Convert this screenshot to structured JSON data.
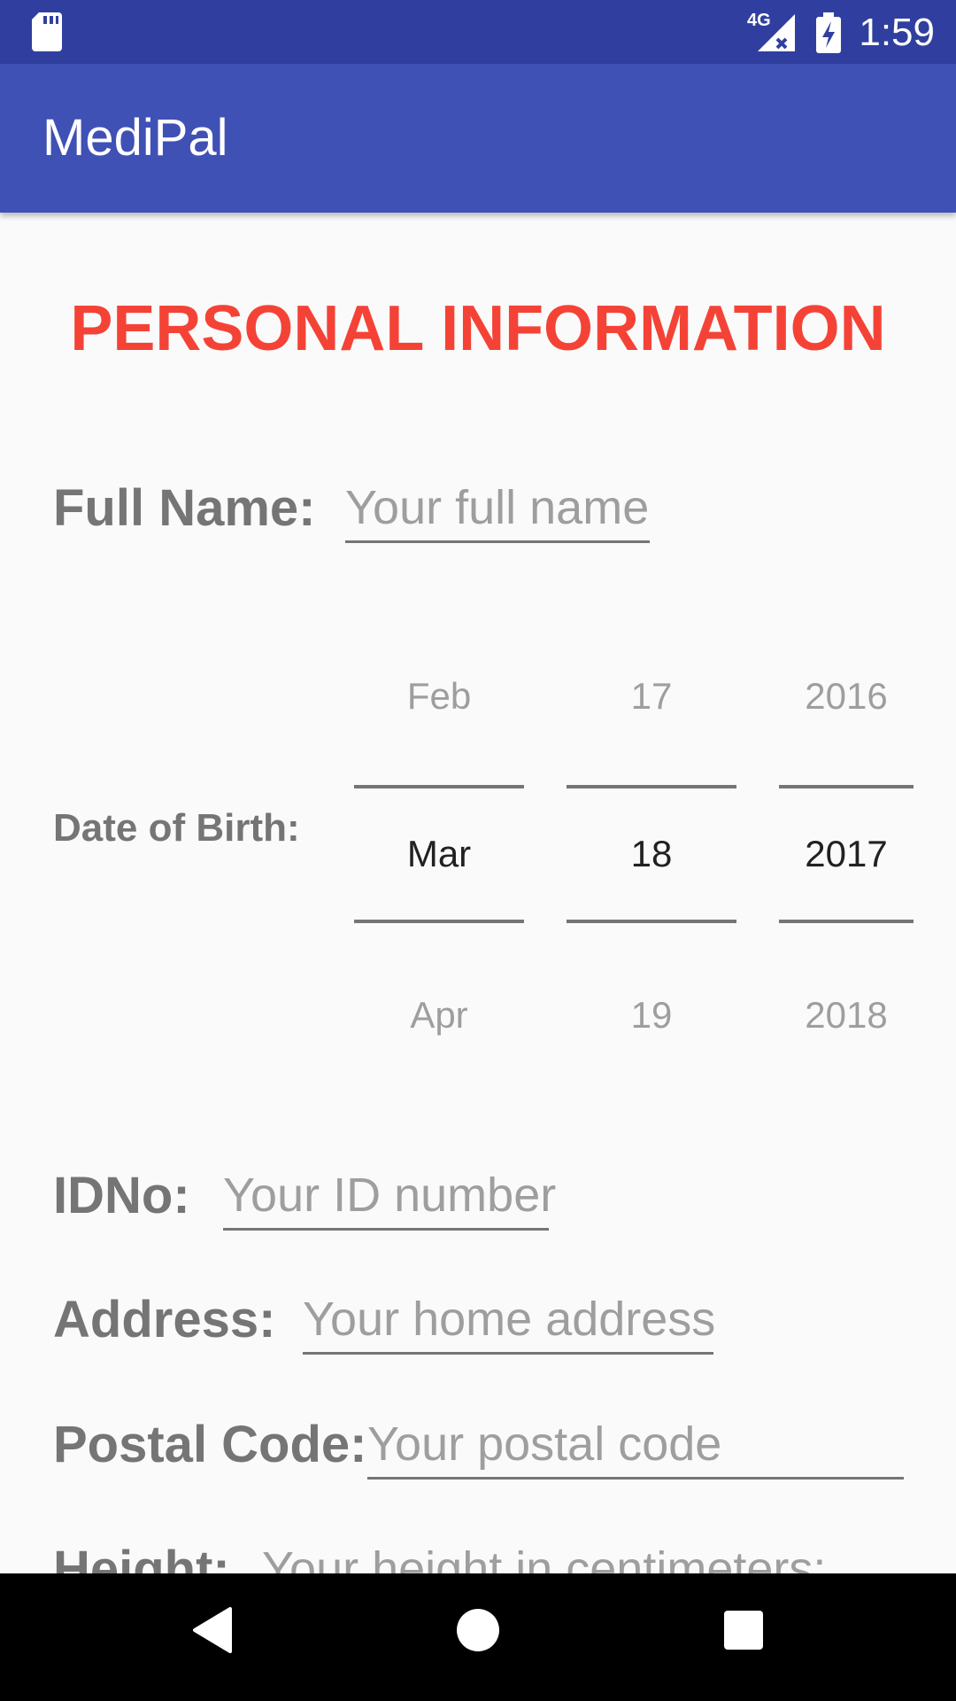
{
  "status_bar": {
    "network": "4G",
    "time": "1:59",
    "icons": [
      "sd-card-icon",
      "signal-icon",
      "battery-icon"
    ]
  },
  "app_bar": {
    "title": "MediPal"
  },
  "form": {
    "section_title": "PERSONAL INFORMATION",
    "full_name": {
      "label": "Full Name:",
      "placeholder": "Your full name"
    },
    "date_of_birth": {
      "label": "Date of Birth:",
      "month": {
        "prev": "Feb",
        "selected": "Mar",
        "next": "Apr"
      },
      "day": {
        "prev": "17",
        "selected": "18",
        "next": "19"
      },
      "year": {
        "prev": "2016",
        "selected": "2017",
        "next": "2018"
      }
    },
    "id_no": {
      "label": "IDNo:",
      "placeholder": "Your ID number"
    },
    "address": {
      "label": "Address:",
      "placeholder": "Your home address"
    },
    "postal_code": {
      "label": "Postal Code:",
      "placeholder": "Your postal code"
    },
    "height": {
      "label": "Height:",
      "placeholder": "Your height in centimeters:"
    }
  },
  "nav_bar": {
    "icons": [
      "back-icon",
      "home-icon",
      "recents-icon"
    ]
  },
  "colors": {
    "status_bar": "#303f9f",
    "app_bar": "#3f51b5",
    "title_accent": "#f44336"
  }
}
